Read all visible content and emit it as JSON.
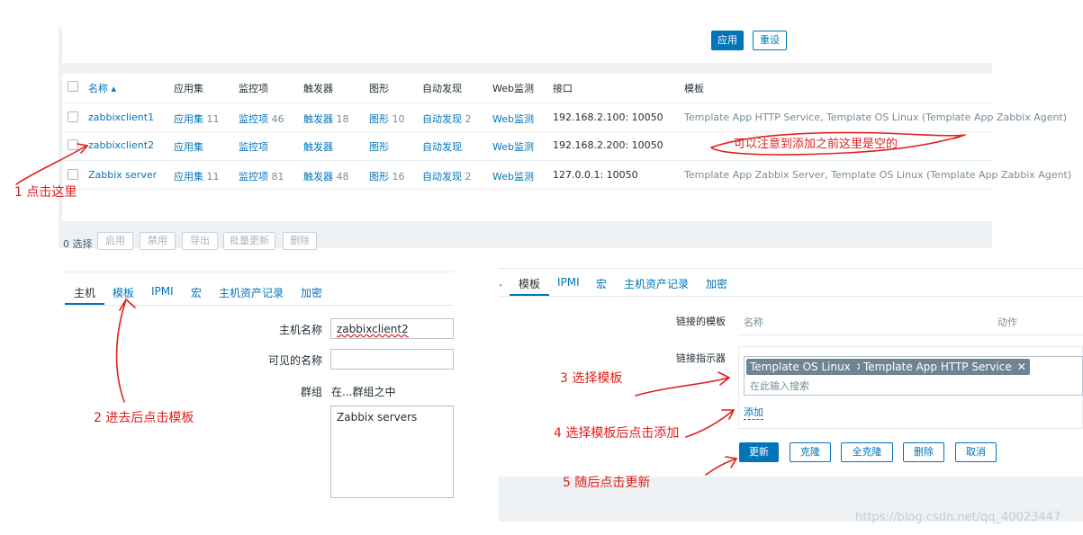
{
  "hosts": {
    "buttons": {
      "apply": "应用",
      "reset": "重设"
    },
    "columns": [
      "名称 ▴",
      "应用集",
      "监控项",
      "触发器",
      "图形",
      "自动发现",
      "Web监测",
      "接口",
      "模板"
    ],
    "rows": [
      {
        "name": "zabbixclient1",
        "apps": "应用集",
        "apps_n": "11",
        "items": "监控项",
        "items_n": "46",
        "triggers": "触发器",
        "triggers_n": "18",
        "graphs": "图形",
        "graphs_n": "10",
        "discovery": "自动发现",
        "discovery_n": "2",
        "web": "Web监测",
        "interface": "192.168.2.100: 10050",
        "templates": [
          "Template App HTTP Service",
          ", ",
          "Template OS Linux",
          " (",
          "Template App Zabbix Agent",
          ")"
        ]
      },
      {
        "name": "zabbixclient2",
        "apps": "应用集",
        "apps_n": "",
        "items": "监控项",
        "items_n": "",
        "triggers": "触发器",
        "triggers_n": "",
        "graphs": "图形",
        "graphs_n": "",
        "discovery": "自动发现",
        "discovery_n": "",
        "web": "Web监测",
        "interface": "192.168.2.200: 10050",
        "templates": []
      },
      {
        "name": "Zabbix server",
        "apps": "应用集",
        "apps_n": "11",
        "items": "监控项",
        "items_n": "81",
        "triggers": "触发器",
        "triggers_n": "48",
        "graphs": "图形",
        "graphs_n": "16",
        "discovery": "自动发现",
        "discovery_n": "2",
        "web": "Web监测",
        "interface": "127.0.0.1: 10050",
        "templates": [
          "Template App Zabbix Server",
          ", ",
          "Template OS Linux",
          " (",
          "Template App Zabbix Agent",
          ")"
        ]
      }
    ],
    "footer": {
      "selected": "0 选择",
      "actions": [
        "启用",
        "禁用",
        "导出",
        "批量更新",
        "删除"
      ]
    }
  },
  "host_form": {
    "tabs": [
      "主机",
      "模板",
      "IPMI",
      "宏",
      "主机资产记录",
      "加密"
    ],
    "labels": {
      "host_name": "主机名称",
      "visible_name": "可见的名称",
      "groups": "群组",
      "in_groups": "在...群组之中"
    },
    "values": {
      "host_name": "zabbixclient2",
      "group": "Zabbix servers"
    }
  },
  "template_form": {
    "tabs": [
      "模板",
      "IPMI",
      "宏",
      "主机资产记录",
      "加密"
    ],
    "linked_label": "链接的模板",
    "linked_columns": [
      "名称",
      "动作"
    ],
    "link_new_label": "链接指示器",
    "selected": [
      "Template OS Linux",
      "Template App HTTP Service"
    ],
    "remove_glyph": "✕",
    "search_placeholder": "在此输入搜索",
    "add": "添加",
    "buttons": [
      "更新",
      "克隆",
      "全克隆",
      "删除",
      "取消"
    ]
  },
  "annotations": {
    "a1": "1 点击这里",
    "a2": "2 进去后点击模板",
    "a3": "3 选择模板",
    "a4": "4 选择模板后点击添加",
    "a5": "5 随后点击更新",
    "empty_note": "可以注意到添加之前这里是空的"
  },
  "watermark": "https://blog.csdn.net/qq_40023447",
  "colors": {
    "accent": "#0275b8",
    "annotation": "#e0201c",
    "tag": "#6f8593",
    "muted": "#768d99"
  }
}
